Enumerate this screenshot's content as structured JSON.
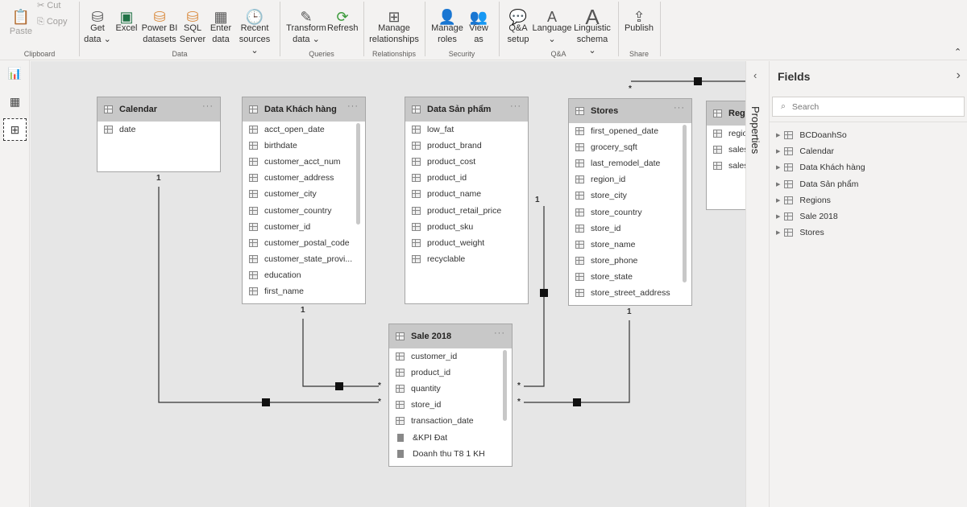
{
  "ribbon": {
    "clipboard": {
      "paste": "Paste",
      "cut": "Cut",
      "copy": "Copy",
      "group": "Clipboard"
    },
    "data": {
      "get_data": [
        "Get",
        "data"
      ],
      "excel": "Excel",
      "powerbi": [
        "Power BI",
        "datasets"
      ],
      "sql": [
        "SQL",
        "Server"
      ],
      "enter": [
        "Enter",
        "data"
      ],
      "recent": [
        "Recent",
        "sources"
      ],
      "group": "Data"
    },
    "queries": {
      "transform": [
        "Transform",
        "data"
      ],
      "refresh": "Refresh",
      "group": "Queries"
    },
    "relationships": {
      "manage": [
        "Manage",
        "relationships"
      ],
      "group": "Relationships"
    },
    "security": {
      "roles": [
        "Manage",
        "roles"
      ],
      "view": [
        "View",
        "as"
      ],
      "group": "Security"
    },
    "qa": {
      "setup": [
        "Q&A",
        "setup"
      ],
      "language": "Language",
      "linguistic": [
        "Linguistic",
        "schema"
      ],
      "group": "Q&A"
    },
    "share": {
      "publish": "Publish",
      "group": "Share"
    }
  },
  "tables": {
    "calendar": {
      "title": "Calendar",
      "fields": [
        "date"
      ]
    },
    "khachhang": {
      "title": "Data Khách hàng",
      "fields": [
        "acct_open_date",
        "birthdate",
        "customer_acct_num",
        "customer_address",
        "customer_city",
        "customer_country",
        "customer_id",
        "customer_postal_code",
        "customer_state_provi...",
        "education",
        "first_name"
      ]
    },
    "sanpham": {
      "title": "Data Sản phẩm",
      "fields": [
        "low_fat",
        "product_brand",
        "product_cost",
        "product_id",
        "product_name",
        "product_retail_price",
        "product_sku",
        "product_weight",
        "recyclable"
      ]
    },
    "stores": {
      "title": "Stores",
      "fields": [
        "first_opened_date",
        "grocery_sqft",
        "last_remodel_date",
        "region_id",
        "store_city",
        "store_country",
        "store_id",
        "store_name",
        "store_phone",
        "store_state",
        "store_street_address"
      ]
    },
    "regions": {
      "title": "Regi",
      "fields": [
        "regio",
        "sales_",
        "sales_"
      ]
    },
    "sale": {
      "title": "Sale 2018",
      "fields": [
        "customer_id",
        "product_id",
        "quantity",
        "store_id",
        "transaction_date"
      ],
      "measures": [
        "&KPI Đat",
        "Doanh thu T8 1 KH"
      ]
    }
  },
  "cardinality": {
    "one": "1",
    "many": "*"
  },
  "properties": {
    "label": "Properties"
  },
  "fields_pane": {
    "title": "Fields",
    "search_placeholder": "Search",
    "items": [
      "BCDoanhSo",
      "Calendar",
      "Data Khách hàng",
      "Data Sản phẩm",
      "Regions",
      "Sale 2018",
      "Stores"
    ]
  }
}
